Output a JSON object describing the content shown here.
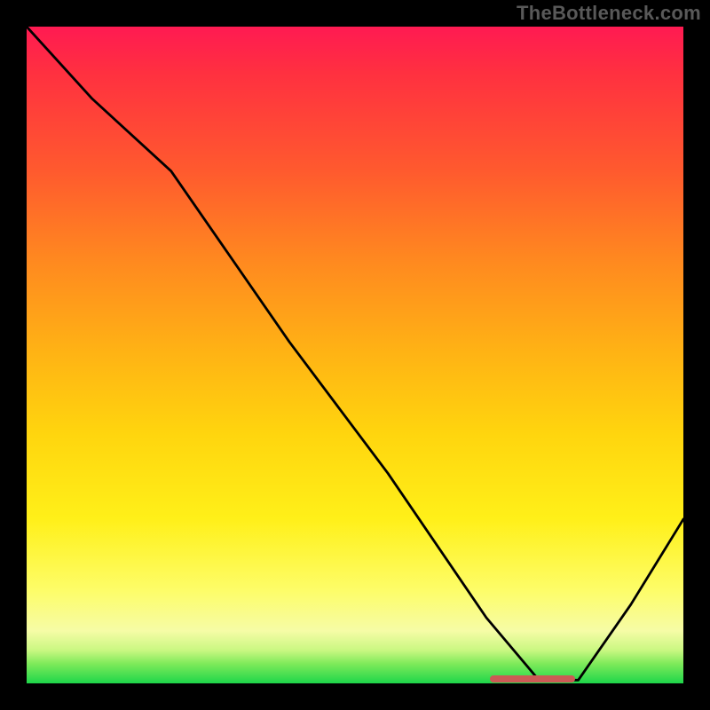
{
  "watermark": "TheBottleneck.com",
  "marker": {
    "left_pct": 70.5,
    "width_pct": 13.0,
    "bottom_pct": 0.2
  },
  "chart_data": {
    "type": "line",
    "title": "",
    "xlabel": "",
    "ylabel": "",
    "xlim": [
      0,
      100
    ],
    "ylim": [
      0,
      100
    ],
    "grid": false,
    "legend": false,
    "series": [
      {
        "name": "curve",
        "x": [
          0,
          10,
          22,
          40,
          55,
          70,
          78,
          84,
          92,
          100
        ],
        "y": [
          100,
          89,
          78,
          52,
          32,
          10,
          0.5,
          0.5,
          12,
          25
        ]
      }
    ],
    "background_gradient_stops": [
      {
        "pct": 0,
        "color": "#ff1a52"
      },
      {
        "pct": 7,
        "color": "#ff3040"
      },
      {
        "pct": 22,
        "color": "#ff5a2e"
      },
      {
        "pct": 36,
        "color": "#ff8a1f"
      },
      {
        "pct": 50,
        "color": "#ffb414"
      },
      {
        "pct": 62,
        "color": "#ffd50e"
      },
      {
        "pct": 75,
        "color": "#fff019"
      },
      {
        "pct": 86,
        "color": "#fdfd6a"
      },
      {
        "pct": 92,
        "color": "#f6fca6"
      },
      {
        "pct": 95,
        "color": "#c9f781"
      },
      {
        "pct": 97,
        "color": "#7fea5a"
      },
      {
        "pct": 100,
        "color": "#1ed64a"
      }
    ],
    "annotations": [
      {
        "type": "range-marker",
        "axis": "x",
        "from": 70.5,
        "to": 83.5,
        "color": "#cc5a55"
      }
    ]
  }
}
